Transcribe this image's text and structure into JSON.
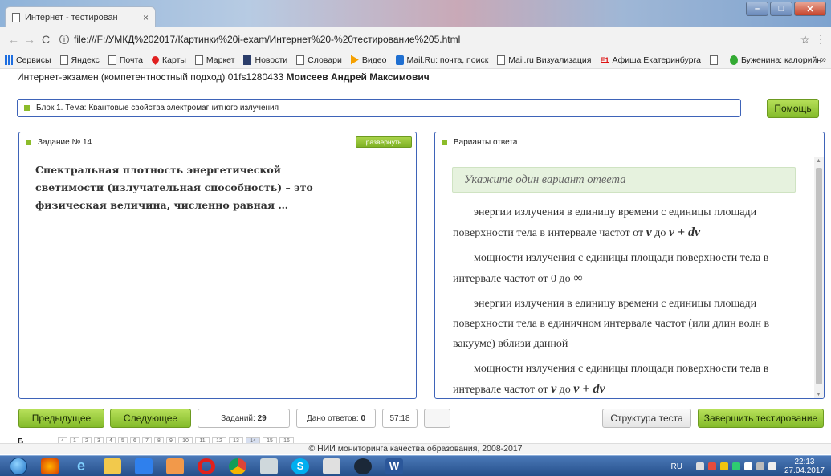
{
  "browser": {
    "tab_title": "Интернет - тестирован",
    "tab_close": "×",
    "url": "file:///F:/УМКД%202017/Картинки%20i-exam/Интернет%20-%20тестирование%205.html",
    "nav_back": "←",
    "nav_forward": "→",
    "nav_reload": "C",
    "info_icon": "i",
    "star_icon": "☆",
    "menu_icon": "⋮",
    "win_min": "–",
    "win_max": "□",
    "win_close": "✕"
  },
  "bookmarks": {
    "items": [
      {
        "label": "Сервисы",
        "icon": "apps-grid-icon"
      },
      {
        "label": "Яндекс",
        "icon": "page-icon"
      },
      {
        "label": "Почта",
        "icon": "page-icon"
      },
      {
        "label": "Карты",
        "icon": "map-pin-icon"
      },
      {
        "label": "Маркет",
        "icon": "page-icon"
      },
      {
        "label": "Новости",
        "icon": "news-icon"
      },
      {
        "label": "Словари",
        "icon": "page-icon"
      },
      {
        "label": "Видео",
        "icon": "video-icon"
      },
      {
        "label": "Mail.Ru: почта, поиск",
        "icon": "mailru-icon"
      },
      {
        "label": "Mail.ru Визуализация",
        "icon": "page-icon"
      },
      {
        "label": "Афиша Екатеринбурга",
        "icon": "e1-icon"
      },
      {
        "label": "",
        "icon": "page-icon"
      },
      {
        "label": "Буженина: калорийн",
        "icon": "green-dot-icon"
      }
    ],
    "e1_text": "E1",
    "more": "»"
  },
  "header": {
    "title": "Интернет-экзамен (компетентностный подход) 01fs1280433",
    "student": "Моисеев Андрей Максимович"
  },
  "block": {
    "label": "Блок 1. Тема: Квантовые свойства электромагнитного излучения",
    "help_label": "Помощь"
  },
  "task": {
    "heading": "Задание № 14",
    "expand_label": "развернуть",
    "question": "Спектральная плотность энергетической светимости (излучательная способность) – это физическая величина, численно равная …"
  },
  "answers": {
    "heading": "Варианты ответа",
    "hint": "Укажите один вариант ответа",
    "options": [
      {
        "text": "энергии излучения в единицу времени с единицы площади поверхности тела в интервале частот от",
        "from": "ν",
        "mid": "до",
        "to": "ν + dν"
      },
      {
        "text": "мощности излучения с единицы площади поверхности тела в интервале частот от 0 до",
        "to": "∞"
      },
      {
        "text": "энергии излучения в единицу времени с единицы площади поверхности тела в единичном интервале частот (или длин волн в вакууме) вблизи данной"
      },
      {
        "text": "мощности излучения с единицы площади поверхности тела в интервале частот от",
        "from": "ν",
        "mid": "до",
        "to": "ν + dν"
      }
    ]
  },
  "controls": {
    "prev_label": "Предыдущее",
    "next_label": "Следующее",
    "tasks_label": "Заданий:",
    "tasks_count": "29",
    "answered_label": "Дано ответов:",
    "answered_count": "0",
    "timer": "57:18",
    "structure_label": "Структура теста",
    "finish_label": "Завершить тестирование"
  },
  "pages": {
    "label": "Б",
    "numbers": [
      "4",
      "1",
      "2",
      "3",
      "4",
      "5",
      "6",
      "7",
      "8",
      "9",
      "10",
      "11",
      "12",
      "13",
      "14",
      "15",
      "16"
    ],
    "current": "14"
  },
  "footer": {
    "copyright": "© НИИ мониторинга качества образования, 2008-2017"
  },
  "taskbar": {
    "apps": [
      "explorer-icon",
      "media-icon",
      "ie-icon",
      "folder-icon",
      "bitrix-icon",
      "player-icon",
      "opera-icon",
      "chrome-icon",
      "pen-icon",
      "skype-icon",
      "calc-icon",
      "steam-icon",
      "word-icon"
    ],
    "language": "RU",
    "time": "22:13",
    "date": "27.04.2017"
  }
}
